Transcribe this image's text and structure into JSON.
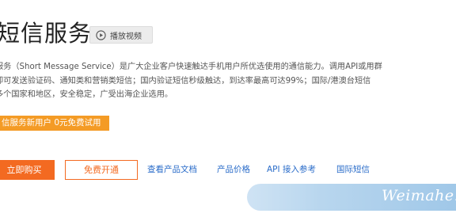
{
  "header": {
    "title": "短信服务",
    "video_button_label": "播放视频"
  },
  "description": {
    "line1": "服务（Short Message Service）是广大企业客户快速触达手机用户所优选使用的通信能力。调用API或用群",
    "line2": "即可发送验证码、通知类和营销类短信；国内验证短信秒级触达，到达率最高可达99%；国际/港澳台短信",
    "line3": "多个国家和地区，安全稳定，广受出海企业选用。"
  },
  "promo": {
    "label": "信服务新用户 0元免费试用"
  },
  "actions": {
    "buy_label": "立即购买",
    "free_label": "免费开通",
    "links": [
      "查看产品文档",
      "产品价格",
      "API 接入参考",
      "国际短信"
    ]
  },
  "watermark": {
    "text": "Weimahe.c"
  },
  "colors": {
    "accent_orange": "#f36a21",
    "promo_orange": "#f49b25",
    "link_blue": "#2a6cc9"
  },
  "icons": {
    "video": "play-circle-icon"
  }
}
